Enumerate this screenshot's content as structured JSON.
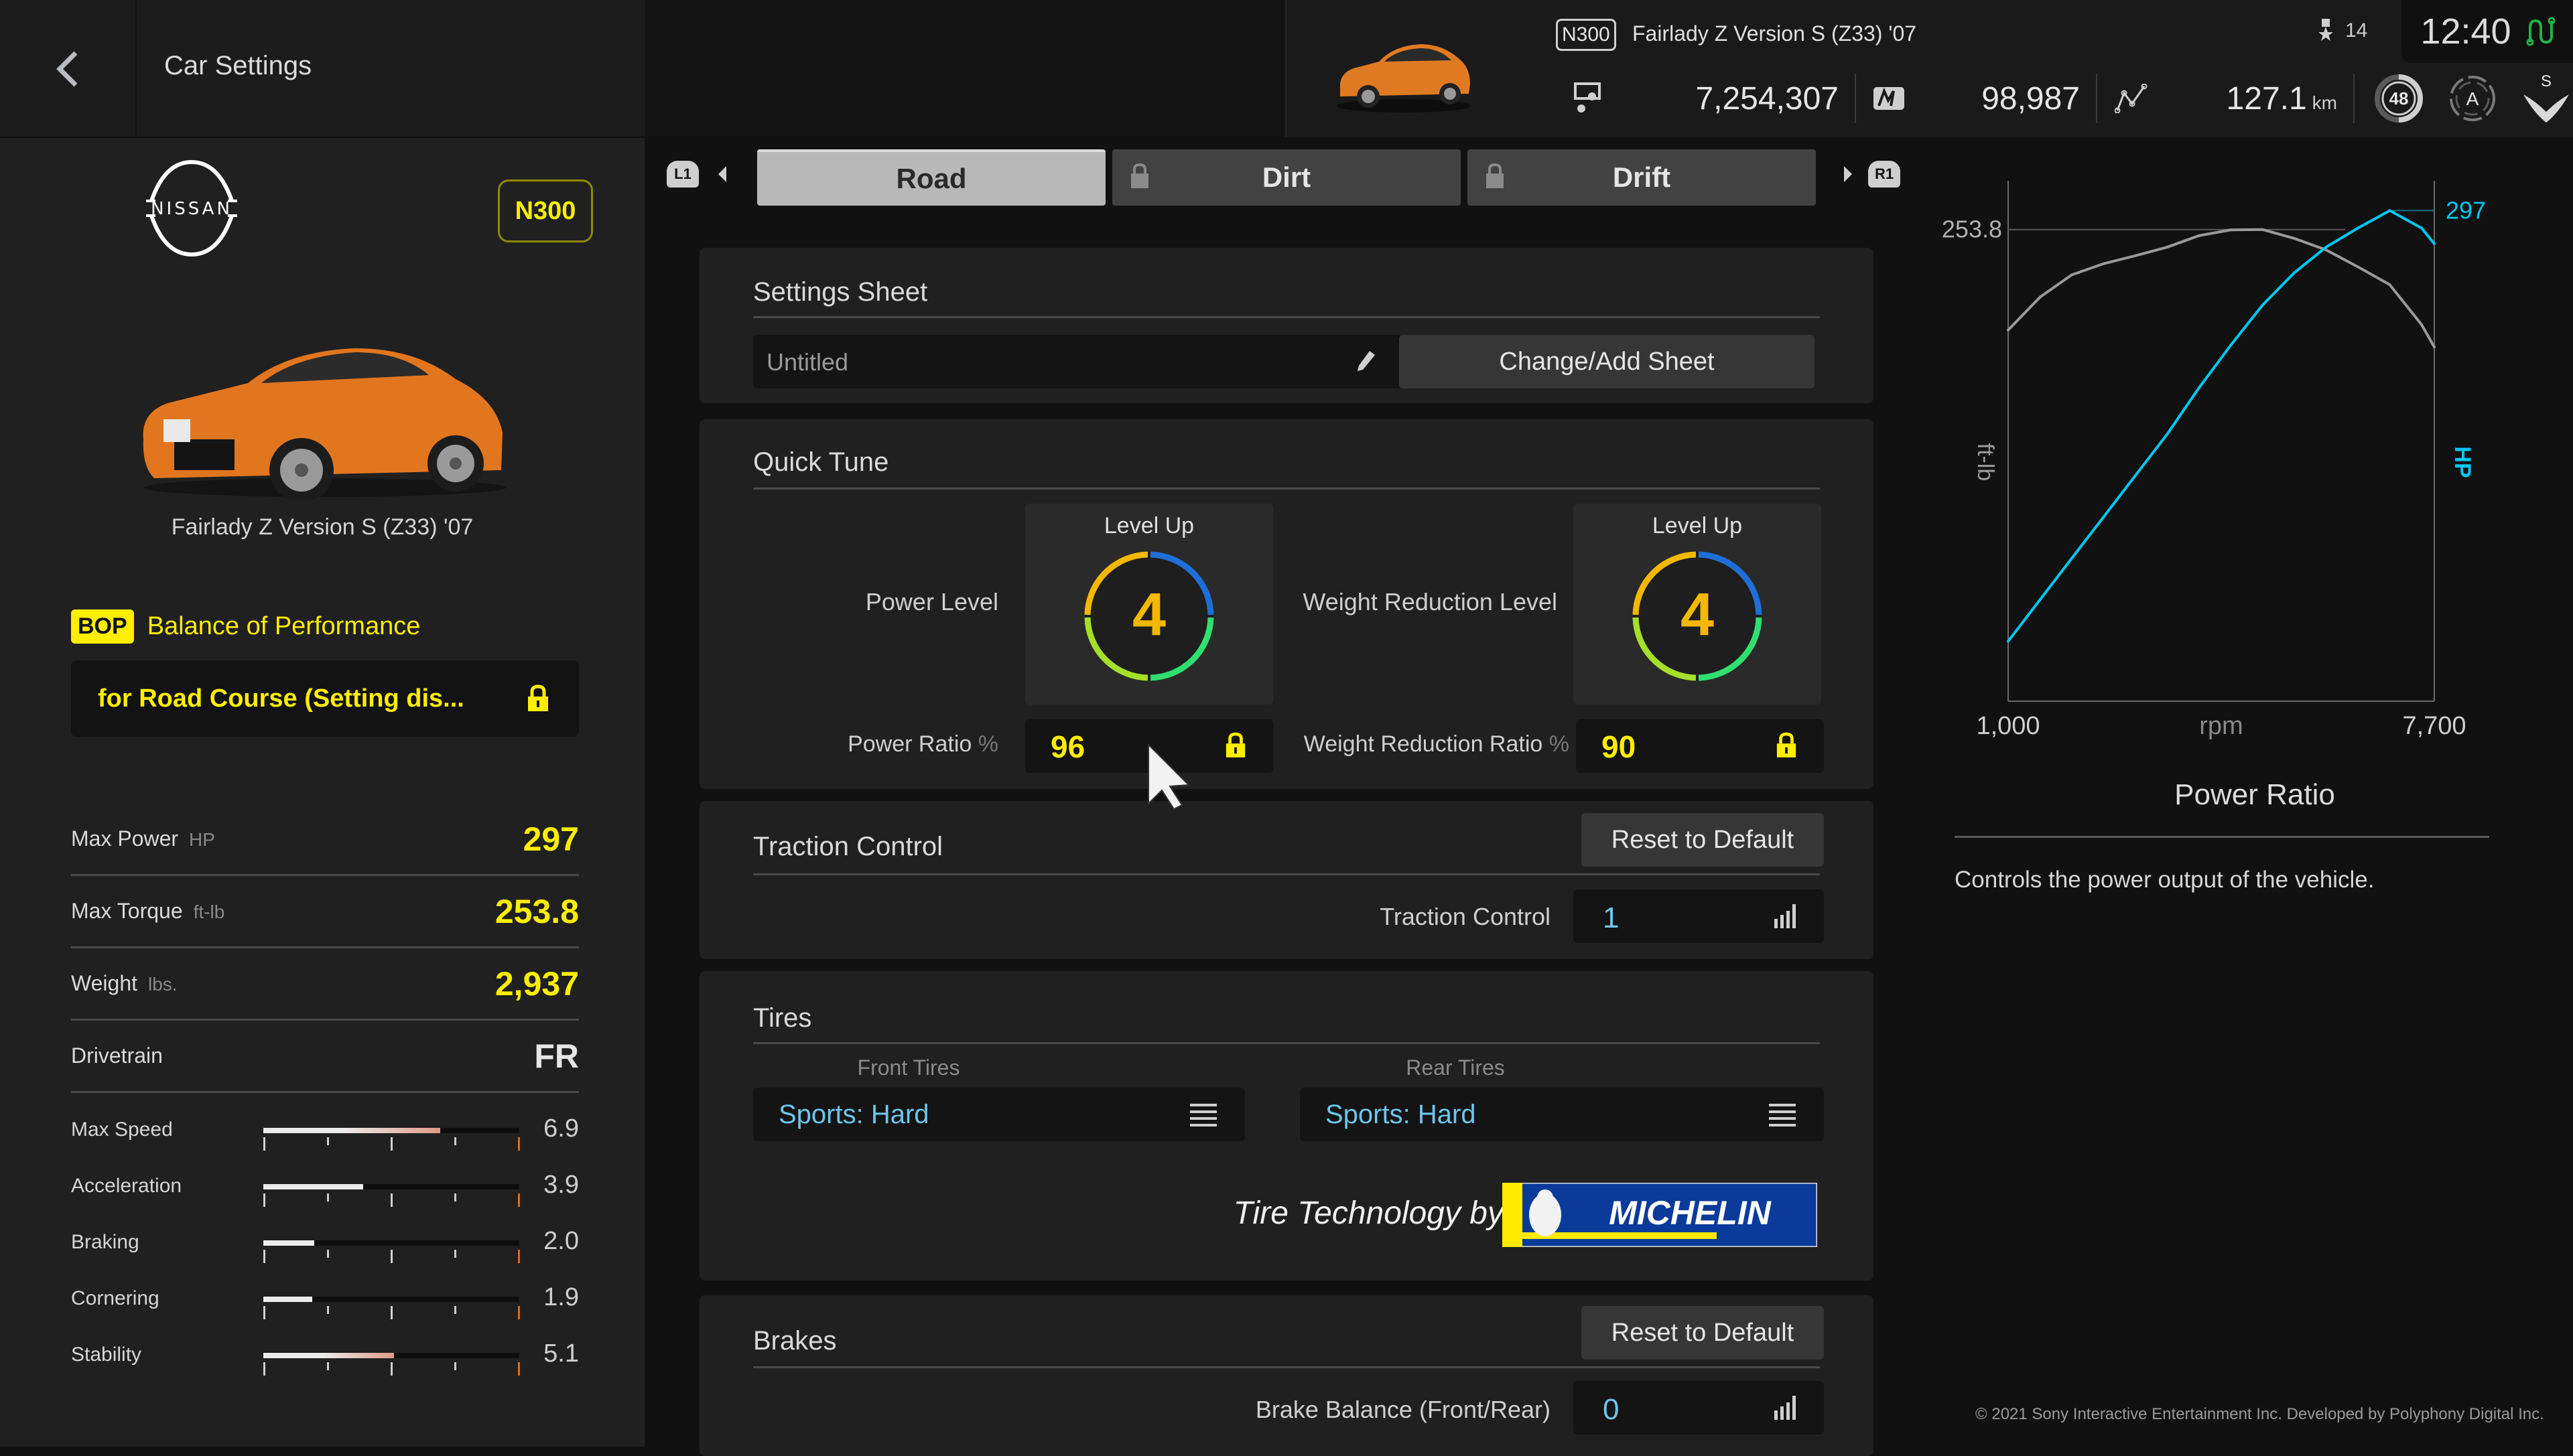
{
  "header": {
    "title": "Car Settings",
    "car_class": "N300",
    "car_name": "Fairlady Z Version S (Z33) '07",
    "medal_count": "14",
    "clock": "12:40",
    "stats": [
      {
        "icon": "credits-icon",
        "value": "7,254,307",
        "unit": ""
      },
      {
        "icon": "mileage-points-icon",
        "value": "98,987",
        "unit": ""
      },
      {
        "icon": "distance-icon",
        "value": "127.1",
        "unit": "km"
      }
    ],
    "level_badge": "48",
    "license_badge": "A",
    "sportsmanship_badge": "S"
  },
  "left": {
    "brand": "NISSAN",
    "class_badge": "N300",
    "car_name": "Fairlady Z Version S (Z33) '07",
    "bop_tag": "BOP",
    "bop_label": "Balance of Performance",
    "bop_setting": "for Road Course (Setting dis...",
    "specs": [
      {
        "label": "Max Power",
        "unit": "HP",
        "value": "297"
      },
      {
        "label": "Max Torque",
        "unit": "ft-lb",
        "value": "253.8"
      },
      {
        "label": "Weight",
        "unit": "lbs.",
        "value": "2,937"
      },
      {
        "label": "Drivetrain",
        "unit": "",
        "value": "FR"
      }
    ],
    "performance_scale_max": 10,
    "performance": [
      {
        "label": "Max Speed",
        "value": "6.9",
        "fraction": 0.69
      },
      {
        "label": "Acceleration",
        "value": "3.9",
        "fraction": 0.39
      },
      {
        "label": "Braking",
        "value": "2.0",
        "fraction": 0.2
      },
      {
        "label": "Cornering",
        "value": "1.9",
        "fraction": 0.19
      },
      {
        "label": "Stability",
        "value": "5.1",
        "fraction": 0.51
      }
    ]
  },
  "tabs": {
    "left_button": "L1",
    "right_button": "R1",
    "items": [
      {
        "label": "Road",
        "active": true,
        "locked": false
      },
      {
        "label": "Dirt",
        "active": false,
        "locked": true
      },
      {
        "label": "Drift",
        "active": false,
        "locked": true
      }
    ]
  },
  "settings_sheet": {
    "title": "Settings Sheet",
    "sheet_name": "Untitled",
    "change_button": "Change/Add Sheet"
  },
  "quick_tune": {
    "title": "Quick Tune",
    "power_level_label": "Power Level",
    "power_level_caption": "Level Up",
    "power_level": "4",
    "weight_level_label": "Weight Reduction Level",
    "weight_level_caption": "Level Up",
    "weight_level": "4",
    "power_ratio_label": "Power Ratio",
    "power_ratio_unit": "%",
    "power_ratio": "96",
    "weight_ratio_label": "Weight Reduction Ratio",
    "weight_ratio_unit": "%",
    "weight_ratio": "90"
  },
  "traction_control": {
    "title": "Traction Control",
    "reset_button": "Reset to Default",
    "field_label": "Traction Control",
    "value": "1"
  },
  "tires": {
    "title": "Tires",
    "front_label": "Front Tires",
    "front_value": "Sports: Hard",
    "rear_label": "Rear Tires",
    "rear_value": "Sports: Hard",
    "tech_label": "Tire Technology by",
    "brand_logo": "MICHELIN"
  },
  "brakes": {
    "title": "Brakes",
    "reset_button": "Reset to Default",
    "field_label": "Brake Balance (Front/Rear)",
    "value": "0"
  },
  "description": {
    "title": "Power Ratio",
    "text": "Controls the power output of the vehicle."
  },
  "copyright": "© 2021 Sony Interactive Entertainment Inc. Developed by Polyphony Digital Inc.",
  "colors": {
    "accent_yellow": "#ffee00",
    "power_curve": "#00c8f0",
    "torque_curve": "#9a9a9a",
    "value_blue": "#6ec6ee"
  },
  "chart_data": {
    "type": "line",
    "title": "",
    "xlabel": "rpm",
    "x_tick_labels": [
      "1,000",
      "7,700"
    ],
    "xlim": [
      1000,
      7700
    ],
    "y_left_label": "ft-lb",
    "y_right_label": "HP",
    "y_left_marker": "253.8",
    "y_right_marker": "297",
    "x": [
      1000,
      1500,
      2000,
      2500,
      3000,
      3500,
      4000,
      4500,
      5000,
      5500,
      6000,
      6500,
      7000,
      7500,
      7700
    ],
    "series": [
      {
        "name": "Torque (ft-lb)",
        "axis": "left",
        "max": 253.8,
        "values": [
          199.7,
          217.4,
          229.4,
          235.4,
          239.7,
          244.3,
          250.5,
          253.6,
          253.8,
          249.0,
          242.8,
          233.7,
          224.1,
          202.6,
          190.6
        ]
      },
      {
        "name": "Power (HP)",
        "axis": "right",
        "max": 297,
        "values": [
          36.3,
          61.4,
          86.5,
          111.5,
          136.6,
          161.6,
          189.7,
          215.5,
          239.8,
          259.4,
          274.9,
          286.4,
          297.0,
          286.4,
          276.9
        ]
      }
    ],
    "y_left_range": [
      0,
      280
    ],
    "y_right_range": [
      0,
      315
    ],
    "grid": false,
    "legend": "none"
  }
}
